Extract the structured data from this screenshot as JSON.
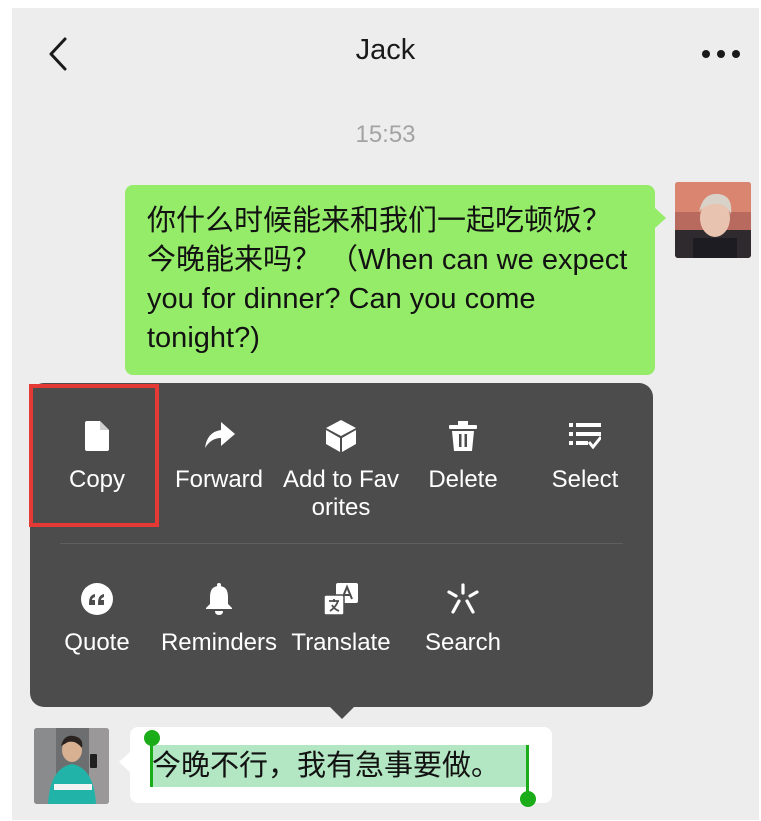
{
  "header": {
    "title": "Jack"
  },
  "timestamp": "15:53",
  "messages": {
    "outgoing": {
      "text": "你什么时候能来和我们一起吃顿饭？今晚能来吗？ （When can we expect you for dinner? Can you come tonight?)"
    },
    "incoming": {
      "text": "今晚不行，我有急事要做。"
    }
  },
  "context_menu": {
    "items": [
      {
        "label": "Copy",
        "icon": "document-icon"
      },
      {
        "label": "Forward",
        "icon": "share-arrow-icon"
      },
      {
        "label": "Add to Favorites",
        "icon": "cube-icon"
      },
      {
        "label": "Delete",
        "icon": "trash-icon"
      },
      {
        "label": "Select",
        "icon": "list-check-icon"
      },
      {
        "label": "Quote",
        "icon": "quote-icon"
      },
      {
        "label": "Reminders",
        "icon": "bell-icon"
      },
      {
        "label": "Translate",
        "icon": "translate-icon"
      },
      {
        "label": "Search",
        "icon": "sparkle-icon"
      }
    ]
  },
  "colors": {
    "outgoing_bubble": "#95ec69",
    "menu_background": "#4c4c4c",
    "selection_handle": "#1aad19",
    "highlight_border": "#e53935"
  }
}
